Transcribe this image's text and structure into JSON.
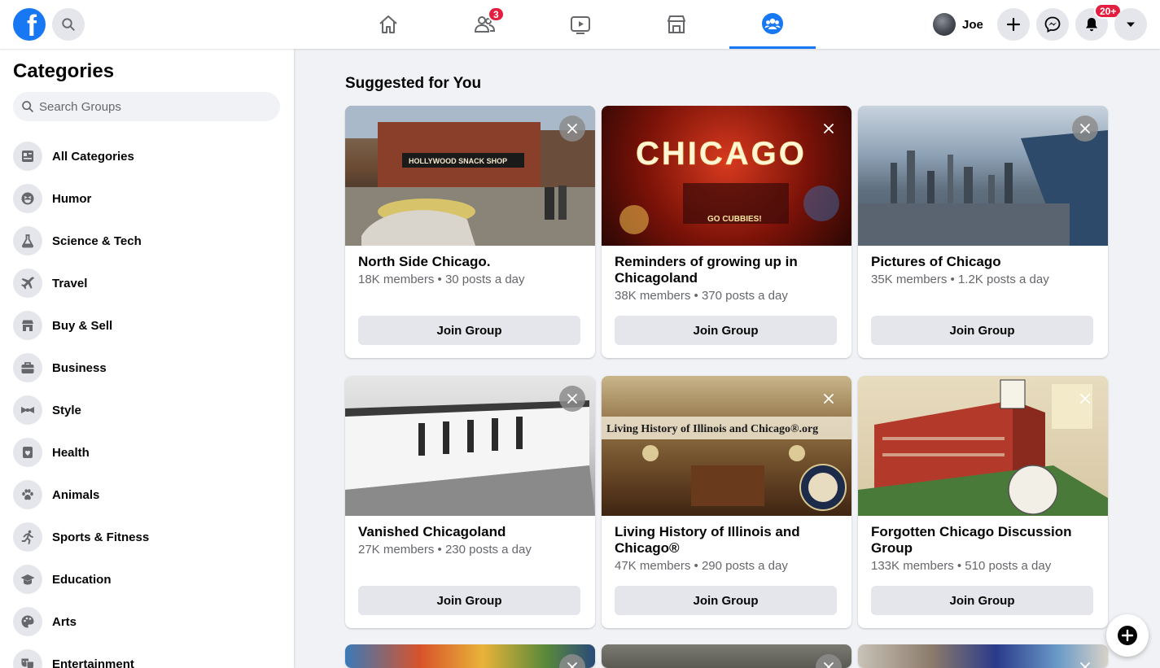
{
  "topbar": {
    "logo_letter": "f",
    "friends_badge": "3",
    "notifications_badge": "20+",
    "profile_name": "Joe",
    "brand_color": "#1877f2"
  },
  "sidebar": {
    "title": "Categories",
    "search_placeholder": "Search Groups",
    "items": [
      {
        "label": "All Categories",
        "icon": "categories-icon"
      },
      {
        "label": "Humor",
        "icon": "laugh-icon"
      },
      {
        "label": "Science & Tech",
        "icon": "flask-icon"
      },
      {
        "label": "Travel",
        "icon": "airplane-icon"
      },
      {
        "label": "Buy & Sell",
        "icon": "storefront-icon"
      },
      {
        "label": "Business",
        "icon": "briefcase-icon"
      },
      {
        "label": "Style",
        "icon": "bowtie-icon"
      },
      {
        "label": "Health",
        "icon": "heart-bandage-icon"
      },
      {
        "label": "Animals",
        "icon": "paw-icon"
      },
      {
        "label": "Sports & Fitness",
        "icon": "running-icon"
      },
      {
        "label": "Education",
        "icon": "graduation-cap-icon"
      },
      {
        "label": "Arts",
        "icon": "palette-icon"
      },
      {
        "label": "Entertainment",
        "icon": "theater-masks-icon"
      }
    ]
  },
  "main": {
    "title": "Suggested for You",
    "join_label": "Join Group",
    "groups": [
      {
        "name": "North Side Chicago.",
        "meta": "18K members • 30 posts a day",
        "image_text": "HOLLYWOOD SNACK SHOP"
      },
      {
        "name": "Reminders of growing up in Chicagoland",
        "meta": "38K members • 370 posts a day",
        "image_text": "CHICAGO",
        "image_subtext": "GO CUBBIES!"
      },
      {
        "name": "Pictures of Chicago",
        "meta": "35K members • 1.2K posts a day"
      },
      {
        "name": "Vanished Chicagoland",
        "meta": "27K members • 230 posts a day"
      },
      {
        "name": "Living History of Illinois and Chicago®",
        "meta": "47K members • 290 posts a day",
        "image_text": "Living History of Illinois and Chicago®.org"
      },
      {
        "name": "Forgotten Chicago Discussion Group",
        "meta": "133K members • 510 posts a day"
      }
    ]
  }
}
